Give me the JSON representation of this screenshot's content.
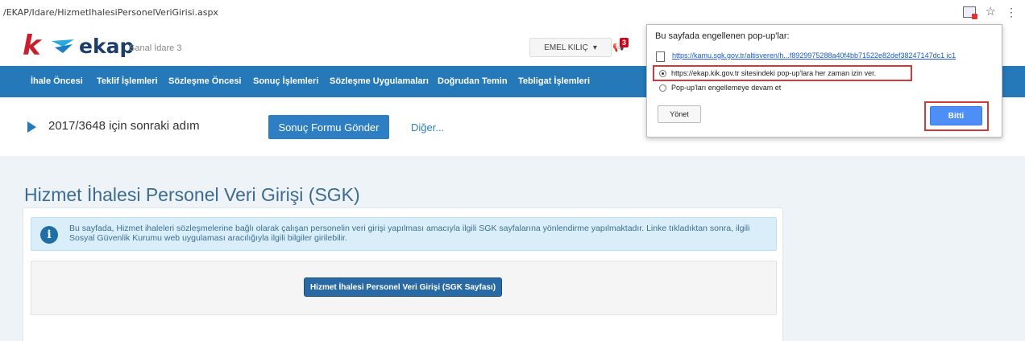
{
  "browser": {
    "url": "/EKAP/Idare/HizmetIhalesiPersonelVeriGirisi.aspx",
    "icons": [
      "popup-blocked-icon",
      "star-icon",
      "menu-icon"
    ]
  },
  "header": {
    "logo_k": "k",
    "logo_text": "ekap",
    "subtitle": "Sanal İdare 3",
    "user_name": "EMEL KILIÇ",
    "notification_count": "3"
  },
  "nav": {
    "items": [
      "İhale Öncesi",
      "Teklif İşlemleri",
      "Sözleşme Öncesi",
      "Sonuç İşlemleri",
      "Sözleşme Uygulamaları",
      "Doğrudan Temin",
      "Tebligat İşlemleri"
    ]
  },
  "step": {
    "text": "2017/3648 için sonraki adım",
    "button": "Sonuç Formu Gönder",
    "link": "Diğer..."
  },
  "main": {
    "title": "Hizmet İhalesi Personel Veri Girişi (SGK)",
    "info": "Bu sayfada, Hizmet ihaleleri sözleşmelerine bağlı olarak çalışan personelin veri girişi yapılması amacıyla ilgili SGK sayfalarına yönlendirme yapılmaktadır. Linke tıkladıktan sonra, ilgili Sosyal Güvenlik Kurumu web uygulaması aracılığıyla ilgili bilgiler girilebilir.",
    "button": "Hizmet İhalesi Personel Veri Girişi (SGK Sayfası)"
  },
  "popup": {
    "title": "Bu sayfada engellenen pop-up'lar:",
    "blocked_link": "https://kamu.sgk.gov.tr/altisveren/h...f8929975288a40f4bb71522e82def38247147dc1 ic1",
    "option_allow": "https://ekap.kik.gov.tr sitesindeki pop-up'lara her zaman izin ver.",
    "option_block": "Pop-up'ları engellemeye devam et",
    "manage_button": "Yönet",
    "done_button": "Bitti"
  },
  "colors": {
    "nav_blue": "#2579b8",
    "accent_red": "#d23a3a",
    "logo_red": "#c71f2d",
    "logo_navy": "#1d3d6b"
  }
}
